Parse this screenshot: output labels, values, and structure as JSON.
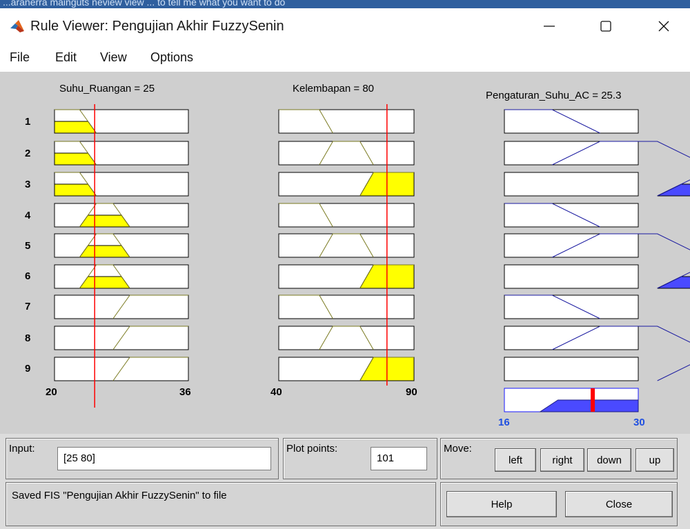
{
  "window": {
    "title": "Rule Viewer: Pengujian Akhir FuzzySenin",
    "background_strip_text": "...aranerra   mainguts   neview   view   ... to   tell me what you want to do"
  },
  "menu": {
    "items": [
      "File",
      "Edit",
      "View",
      "Options"
    ]
  },
  "headers": {
    "input1": "Suhu_Ruangan = 25",
    "input2": "Kelembapan = 80",
    "output": "Pengaturan_Suhu_AC = 25.3"
  },
  "rows": [
    "1",
    "2",
    "3",
    "4",
    "5",
    "6",
    "7",
    "8",
    "9"
  ],
  "axes": {
    "input1": {
      "min": "20",
      "max": "36"
    },
    "input2": {
      "min": "40",
      "max": "90"
    },
    "output": {
      "min": "16",
      "max": "30"
    }
  },
  "input": {
    "label": "Input:",
    "value": "[25 80]"
  },
  "plot_points": {
    "label": "Plot points:",
    "value": "101"
  },
  "move": {
    "label": "Move:",
    "buttons": [
      "left",
      "right",
      "down",
      "up"
    ]
  },
  "status": "Saved FIS \"Pengujian Akhir FuzzySenin\" to file",
  "actions": {
    "help": "Help",
    "close": "Close"
  },
  "fuzzy": {
    "input1_mfs": [
      [
        [
          0,
          1
        ],
        [
          3,
          1
        ],
        [
          5,
          0
        ]
      ],
      [
        [
          0,
          1
        ],
        [
          3,
          1
        ],
        [
          5,
          0
        ]
      ],
      [
        [
          0,
          1
        ],
        [
          3,
          1
        ],
        [
          5,
          0
        ]
      ],
      [
        [
          3,
          0
        ],
        [
          5,
          1
        ],
        [
          7,
          1
        ],
        [
          9,
          0
        ]
      ],
      [
        [
          3,
          0
        ],
        [
          5,
          1
        ],
        [
          7,
          1
        ],
        [
          9,
          0
        ]
      ],
      [
        [
          3,
          0
        ],
        [
          5,
          1
        ],
        [
          7,
          1
        ],
        [
          9,
          0
        ]
      ],
      [
        [
          7,
          0
        ],
        [
          9,
          1
        ],
        [
          16,
          1
        ]
      ],
      [
        [
          7,
          0
        ],
        [
          9,
          1
        ],
        [
          16,
          1
        ]
      ],
      [
        [
          7,
          0
        ],
        [
          9,
          1
        ],
        [
          16,
          1
        ]
      ]
    ],
    "input1_firing": [
      0.5,
      0.5,
      0.5,
      0.5,
      0.5,
      0.5,
      0,
      0,
      0
    ],
    "input2_mfs": [
      [
        [
          0,
          1
        ],
        [
          15,
          1
        ],
        [
          20,
          0
        ]
      ],
      [
        [
          15,
          0
        ],
        [
          20,
          1
        ],
        [
          30,
          1
        ],
        [
          35,
          0
        ]
      ],
      [
        [
          30,
          0
        ],
        [
          35,
          1
        ],
        [
          50,
          1
        ]
      ],
      [
        [
          0,
          1
        ],
        [
          15,
          1
        ],
        [
          20,
          0
        ]
      ],
      [
        [
          15,
          0
        ],
        [
          20,
          1
        ],
        [
          30,
          1
        ],
        [
          35,
          0
        ]
      ],
      [
        [
          30,
          0
        ],
        [
          35,
          1
        ],
        [
          50,
          1
        ]
      ],
      [
        [
          0,
          1
        ],
        [
          15,
          1
        ],
        [
          20,
          0
        ]
      ],
      [
        [
          15,
          0
        ],
        [
          20,
          1
        ],
        [
          30,
          1
        ],
        [
          35,
          0
        ]
      ],
      [
        [
          30,
          0
        ],
        [
          35,
          1
        ],
        [
          50,
          1
        ]
      ]
    ],
    "input2_firing": [
      0,
      0,
      1,
      0,
      0,
      1,
      0,
      0,
      1
    ],
    "output_mfs": [
      [
        [
          0,
          1
        ],
        [
          5,
          1
        ],
        [
          10,
          0
        ]
      ],
      [
        [
          5,
          0
        ],
        [
          10,
          1
        ],
        [
          16,
          1
        ],
        [
          21,
          0
        ]
      ],
      [
        [
          16,
          0
        ],
        [
          21,
          1
        ],
        [
          30,
          1
        ]
      ],
      [
        [
          0,
          1
        ],
        [
          5,
          1
        ],
        [
          10,
          0
        ]
      ],
      [
        [
          5,
          0
        ],
        [
          10,
          1
        ],
        [
          16,
          1
        ],
        [
          21,
          0
        ]
      ],
      [
        [
          16,
          0
        ],
        [
          21,
          1
        ],
        [
          30,
          1
        ]
      ],
      [
        [
          0,
          1
        ],
        [
          5,
          1
        ],
        [
          10,
          0
        ]
      ],
      [
        [
          5,
          0
        ],
        [
          10,
          1
        ],
        [
          16,
          1
        ],
        [
          21,
          0
        ]
      ],
      [
        [
          16,
          0
        ],
        [
          21,
          1
        ],
        [
          30,
          1
        ]
      ]
    ],
    "output_firing": [
      0,
      0,
      0.5,
      0,
      0,
      0.5,
      0,
      0,
      0
    ],
    "input1_value_fraction": 0.3,
    "input2_value_fraction": 0.8,
    "output_value_fraction": 0.66,
    "aggregate_level": 0.5
  },
  "colors": {
    "panel": "#cfcfcf",
    "input_mf_line": "#7a7a20",
    "input_fill": "#ffff00",
    "output_mf_line": "#1a1aa0",
    "output_fill": "#4a4aff",
    "marker_line": "#ff0000",
    "output_result": "#ff0000"
  }
}
